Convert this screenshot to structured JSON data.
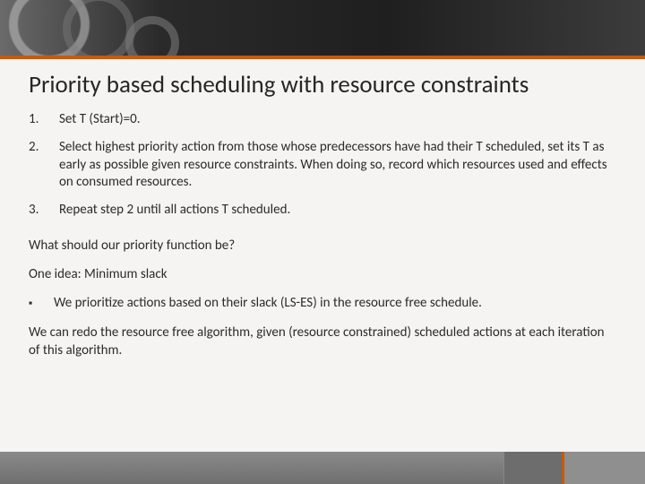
{
  "title": "Priority based scheduling with resource constraints",
  "steps": [
    "Set T (Start)=0.",
    "Select highest priority action from those whose predecessors have had their T scheduled, set its T as early as possible given resource constraints. When doing so, record which resources used and effects on consumed resources.",
    "Repeat step 2 until all actions T scheduled."
  ],
  "question": "What should our priority function be?",
  "idea": "One idea: Minimum slack",
  "bullets": [
    "We prioritize actions based on their slack (LS-ES) in the resource free schedule."
  ],
  "closing": "We can redo the resource free algorithm, given (resource constrained) scheduled actions at each iteration of this algorithm."
}
